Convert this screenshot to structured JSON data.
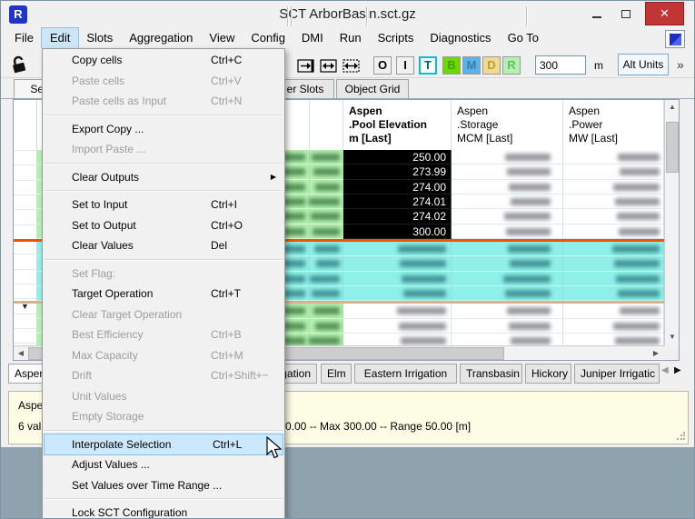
{
  "window": {
    "title": "SCT ArborBasin.sct.gz"
  },
  "menubar": {
    "items": [
      {
        "label": "File"
      },
      {
        "label": "Edit",
        "highlighted": true
      },
      {
        "label": "Slots"
      },
      {
        "label": "Aggregation"
      },
      {
        "label": "View"
      },
      {
        "label": "Config"
      },
      {
        "label": "DMI"
      },
      {
        "label": "Run"
      },
      {
        "label": "Scripts"
      },
      {
        "label": "Diagnostics"
      },
      {
        "label": "Go To"
      }
    ]
  },
  "toolbar": {
    "value": "300",
    "unit": "m",
    "alt_units_label": "Alt Units",
    "overflow": "»",
    "icon_buttons": [
      "lock-icon",
      "fit-column-right-icon",
      "fit-column-width-icon",
      "fit-all-columns-icon"
    ],
    "letter_buttons": [
      {
        "label": "O",
        "bg": "#f0f0f0",
        "fg": "#000000",
        "toggled": false
      },
      {
        "label": "I",
        "bg": "#f0f0f0",
        "fg": "#000000",
        "toggled": false
      },
      {
        "label": "T",
        "bg": "#ffffff",
        "fg": "#00606e",
        "toggled": true
      },
      {
        "label": "B",
        "bg": "#6ed800",
        "fg": "#3fa000",
        "toggled": false
      },
      {
        "label": "M",
        "bg": "#5ab2e8",
        "fg": "#3c7ca8",
        "toggled": false
      },
      {
        "label": "D",
        "bg": "#eeda92",
        "fg": "#c0a028",
        "toggled": false
      },
      {
        "label": "R",
        "bg": "#b4f0b0",
        "fg": "#5fc06a",
        "toggled": false
      }
    ]
  },
  "top_tabs": [
    {
      "label": "Seri",
      "active": true
    },
    {
      "label": "er Slots",
      "active": false
    },
    {
      "label": "Object Grid",
      "active": false
    }
  ],
  "table": {
    "columns": [
      {
        "header_lines": [
          "Aspen",
          ".Pool Elevation",
          "m [Last]"
        ],
        "bold": true,
        "selected_values": [
          "250.00",
          "273.99",
          "274.00",
          "274.01",
          "274.02",
          "300.00"
        ]
      },
      {
        "header_lines": [
          "Aspen",
          ".Storage",
          "MCM [Last]"
        ],
        "bold": false
      },
      {
        "header_lines": [
          "Aspen",
          ".Power",
          "MW [Last]"
        ],
        "bold": false
      }
    ],
    "sections": [
      {
        "rows": 6,
        "style": "green",
        "selected": true
      },
      {
        "rows": 4,
        "style": "cyan",
        "selected": false
      },
      {
        "rows": 3,
        "style": "green",
        "selected": false
      }
    ]
  },
  "bottom_tabs": [
    {
      "label": "Aspen",
      "active": true
    },
    {
      "label": "gation",
      "active": false
    },
    {
      "label": "Elm",
      "active": false
    },
    {
      "label": "Eastern Irrigation",
      "active": false
    },
    {
      "label": "Transbasin",
      "active": false
    },
    {
      "label": "Hickory",
      "active": false
    },
    {
      "label": "Juniper Irrigatic",
      "active": false
    }
  ],
  "edit_menu": {
    "items": [
      {
        "label": "Copy cells",
        "shortcut": "Ctrl+C",
        "enabled": true
      },
      {
        "label": "Paste cells",
        "shortcut": "Ctrl+V",
        "enabled": false
      },
      {
        "label": "Paste cells as Input",
        "shortcut": "Ctrl+N",
        "enabled": false
      },
      {
        "separator": true
      },
      {
        "label": "Export Copy ...",
        "shortcut": "",
        "enabled": true
      },
      {
        "label": "Import Paste ...",
        "shortcut": "",
        "enabled": false
      },
      {
        "separator": true
      },
      {
        "label": "Clear Outputs",
        "shortcut": "",
        "enabled": true,
        "submenu": true
      },
      {
        "separator": true
      },
      {
        "label": "Set to Input",
        "shortcut": "Ctrl+I",
        "enabled": true
      },
      {
        "label": "Set to Output",
        "shortcut": "Ctrl+O",
        "enabled": true
      },
      {
        "label": "Clear Values",
        "shortcut": "Del",
        "enabled": true
      },
      {
        "separator": true
      },
      {
        "label": "Set Flag:",
        "shortcut": "",
        "enabled": false
      },
      {
        "label": "Target Operation",
        "shortcut": "Ctrl+T",
        "enabled": true
      },
      {
        "label": "Clear Target Operation",
        "shortcut": "",
        "enabled": false
      },
      {
        "label": "Best Efficiency",
        "shortcut": "Ctrl+B",
        "enabled": false
      },
      {
        "label": "Max Capacity",
        "shortcut": "Ctrl+M",
        "enabled": false
      },
      {
        "label": "Drift",
        "shortcut": "Ctrl+Shift+~",
        "enabled": false
      },
      {
        "label": "Unit Values",
        "shortcut": "",
        "enabled": false
      },
      {
        "label": "Empty Storage",
        "shortcut": "",
        "enabled": false
      },
      {
        "separator": true
      },
      {
        "label": "Interpolate Selection",
        "shortcut": "Ctrl+L",
        "enabled": true,
        "highlighted": true
      },
      {
        "label": "Adjust Values ...",
        "shortcut": "",
        "enabled": true
      },
      {
        "label": "Set Values over Time Range ...",
        "shortcut": "",
        "enabled": true
      },
      {
        "separator": true
      },
      {
        "label": "Lock SCT Configuration",
        "shortcut": "",
        "enabled": true
      }
    ]
  },
  "info_panel": {
    "line1": "Aspen",
    "line2_left": "6 valu",
    "line2_right": "0.00 -- Max 300.00 -- Range 50.00 [m]"
  },
  "colors": {
    "flag_green": "#b2f0ad",
    "flag_cyan": "#8ef0e8",
    "divider_orange": "#ea5506",
    "divider_tan": "#d9b287",
    "menu_highlight": "#cbe8ff",
    "close_red": "#c13535"
  }
}
